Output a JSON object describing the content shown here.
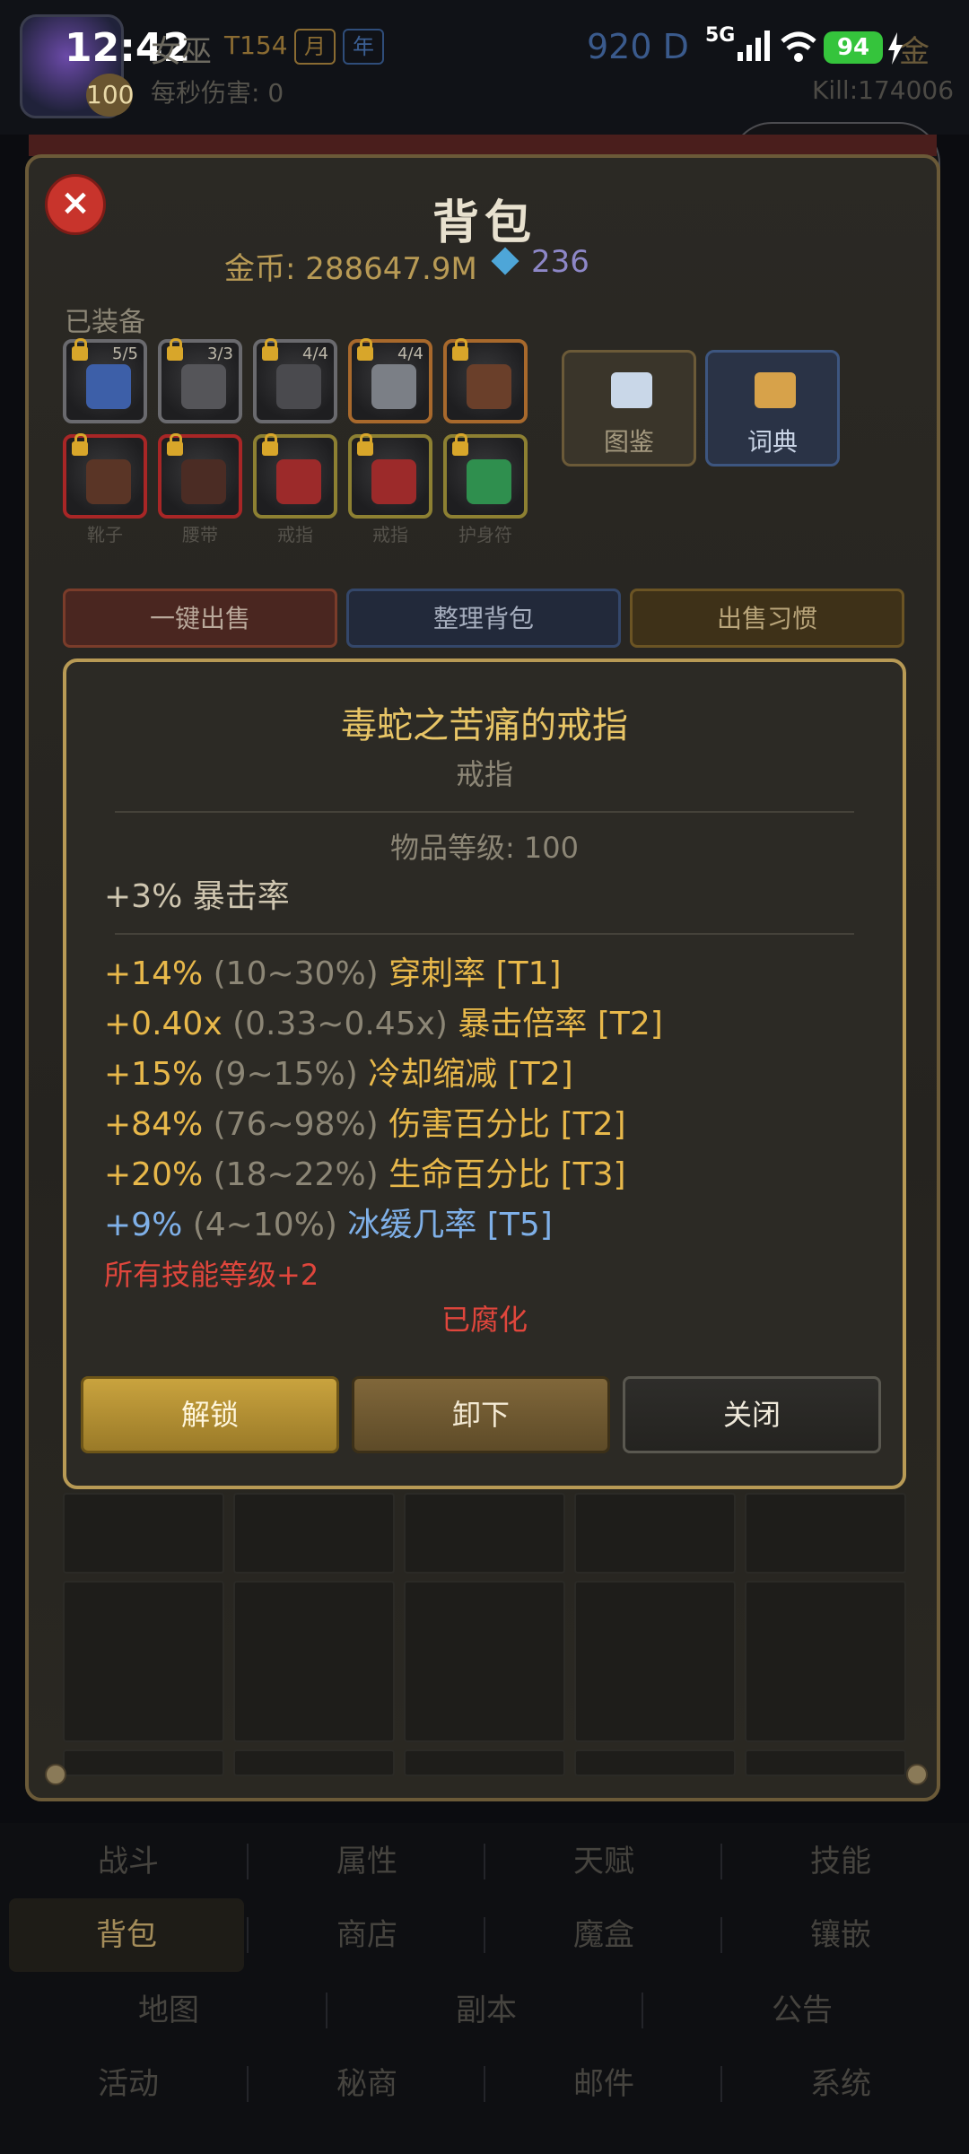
{
  "status": {
    "time": "12:42",
    "battery": "94",
    "network": "5G"
  },
  "header": {
    "hero_name": "女巫",
    "tier": "T154",
    "tag_month": "月",
    "tag_year": "年",
    "level_badge": "100",
    "dps": "每秒伤害: 0",
    "d_value": "920 D",
    "gold_short": "金",
    "kills": "Kill:174006"
  },
  "panel": {
    "title": "背包",
    "gold": "金币: 288647.9M",
    "gems": "236",
    "equipped_label": "已装备",
    "slots": [
      {
        "count": "5/5",
        "label": "",
        "border": "gray",
        "color": "#3d5fa8"
      },
      {
        "count": "3/3",
        "label": "",
        "border": "gray",
        "color": "#555559"
      },
      {
        "count": "4/4",
        "label": "",
        "border": "gray",
        "color": "#4a4a4e"
      },
      {
        "count": "4/4",
        "label": "",
        "border": "orange",
        "color": "#7b7f86"
      },
      {
        "count": "",
        "label": "",
        "border": "orange",
        "color": "#6a3f2a"
      },
      {
        "count": "",
        "label": "靴子",
        "border": "red",
        "color": "#5a3526"
      },
      {
        "count": "",
        "label": "腰带",
        "border": "red",
        "color": "#4b2c24"
      },
      {
        "count": "",
        "label": "戒指",
        "border": "yellow",
        "color": "#9c2a2a"
      },
      {
        "count": "",
        "label": "戒指",
        "border": "yellow",
        "color": "#9c2a2a"
      },
      {
        "count": "",
        "label": "护身符",
        "border": "yellow",
        "color": "#2f8f4e"
      }
    ],
    "btn_atlas": "图鉴",
    "btn_dict": "词典",
    "btn_sell_all": "一键出售",
    "btn_sort": "整理背包",
    "btn_sell_habit": "出售习惯"
  },
  "item": {
    "name": "毒蛇之苦痛的戒指",
    "type": "戒指",
    "item_level": "物品等级: 100",
    "implicit": "+3% 暴击率",
    "affixes": [
      {
        "value": "+14%",
        "range": "(10~30%)",
        "name": "穿刺率 [T1]",
        "color": "gold"
      },
      {
        "value": "+0.40x",
        "range": "(0.33~0.45x)",
        "name": "暴击倍率 [T2]",
        "color": "gold"
      },
      {
        "value": "+15%",
        "range": "(9~15%)",
        "name": "冷却缩减 [T2]",
        "color": "gold"
      },
      {
        "value": "+84%",
        "range": "(76~98%)",
        "name": "伤害百分比 [T2]",
        "color": "gold"
      },
      {
        "value": "+20%",
        "range": "(18~22%)",
        "name": "生命百分比 [T3]",
        "color": "gold"
      },
      {
        "value": "+9%",
        "range": "(4~10%)",
        "name": "冰缓几率 [T5]",
        "color": "blue"
      }
    ],
    "skill_bonus": "所有技能等级+2",
    "corrupted": "已腐化",
    "btn_unlock": "解锁",
    "btn_unequip": "卸下",
    "btn_close": "关闭"
  },
  "nav": {
    "row1": [
      "战斗",
      "属性",
      "天赋",
      "技能"
    ],
    "row2": [
      "背包",
      "商店",
      "魔盒",
      "镶嵌"
    ],
    "row3": [
      "地图",
      "副本",
      "公告"
    ],
    "row4": [
      "活动",
      "秘商",
      "邮件",
      "系统"
    ],
    "active": "背包"
  }
}
